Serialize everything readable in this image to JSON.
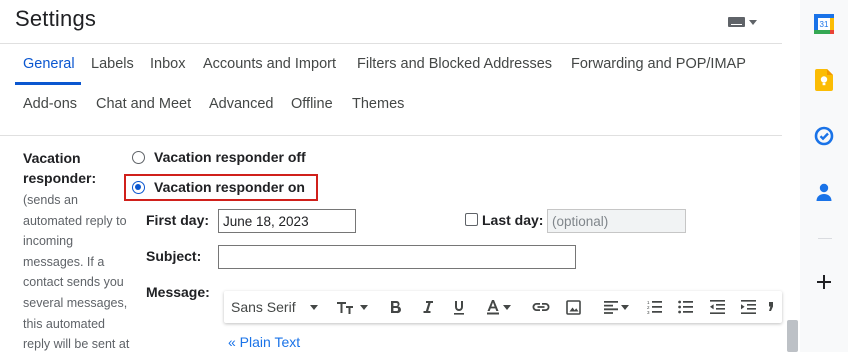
{
  "page": {
    "title": "Settings"
  },
  "tabs": [
    {
      "label": "General",
      "active": true
    },
    {
      "label": "Labels"
    },
    {
      "label": "Inbox"
    },
    {
      "label": "Accounts and Import"
    },
    {
      "label": "Filters and Blocked Addresses"
    },
    {
      "label": "Forwarding and POP/IMAP"
    },
    {
      "label": "Add-ons"
    },
    {
      "label": "Chat and Meet"
    },
    {
      "label": "Advanced"
    },
    {
      "label": "Offline"
    },
    {
      "label": "Themes"
    }
  ],
  "vacation": {
    "label": "Vacation responder:",
    "description": "(sends an automated reply to incoming messages. If a contact sends you several messages, this automated reply will be sent at",
    "off_label": "Vacation responder off",
    "on_label": "Vacation responder on",
    "selected": "on",
    "first_day_label": "First day:",
    "first_day_value": "June 18, 2023",
    "last_day_label": "Last day:",
    "last_day_placeholder": "(optional)",
    "last_day_checked": false,
    "subject_label": "Subject:",
    "subject_value": "",
    "message_label": "Message:",
    "plain_text_link": "« Plain Text"
  },
  "toolbar": {
    "font": "Sans Serif",
    "items": [
      "font-select",
      "text-size-icon",
      "bold-icon",
      "italic-icon",
      "underline-icon",
      "text-color-icon",
      "link-icon",
      "image-icon",
      "align-icon",
      "numbered-list-icon",
      "bulleted-list-icon",
      "indent-less-icon",
      "indent-more-icon",
      "quote-icon"
    ]
  },
  "side_panel": {
    "icons": [
      "calendar-icon",
      "keep-icon",
      "tasks-icon",
      "contacts-icon",
      "add-icon"
    ],
    "calendar_day": "31"
  },
  "colors": {
    "accent": "#0b57d0",
    "highlight": "#d0201b",
    "link": "#1a73e8"
  }
}
